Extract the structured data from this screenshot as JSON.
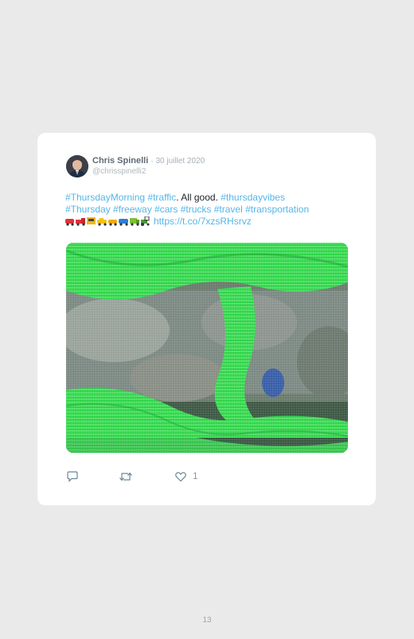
{
  "tweet": {
    "author_name": "Chris Spinelli",
    "date": "· 30 juillet 2020",
    "handle": "@chrisspinelli2",
    "line1": {
      "tag1": "#ThursdayMorning",
      "tag2": "#traffic",
      "plain": ". All good. ",
      "tag3": "#thursdayvibes"
    },
    "line2": "#Thursday #freeway #cars #trucks #travel #transportation",
    "emojis": "🚗🚛🚧🚕🚖🚙🚚🚜",
    "link": "https://t.co/7xzsRHsrvz",
    "like_count": "1"
  },
  "icons": {
    "reply": "reply-icon",
    "retweet": "retweet-icon",
    "like": "heart-icon"
  },
  "page": {
    "number": "13"
  },
  "colors": {
    "background": "#ebeaea",
    "card": "#ffffff",
    "hashtag": "#56b5e8",
    "highway_overlay": "#2fd44a"
  }
}
